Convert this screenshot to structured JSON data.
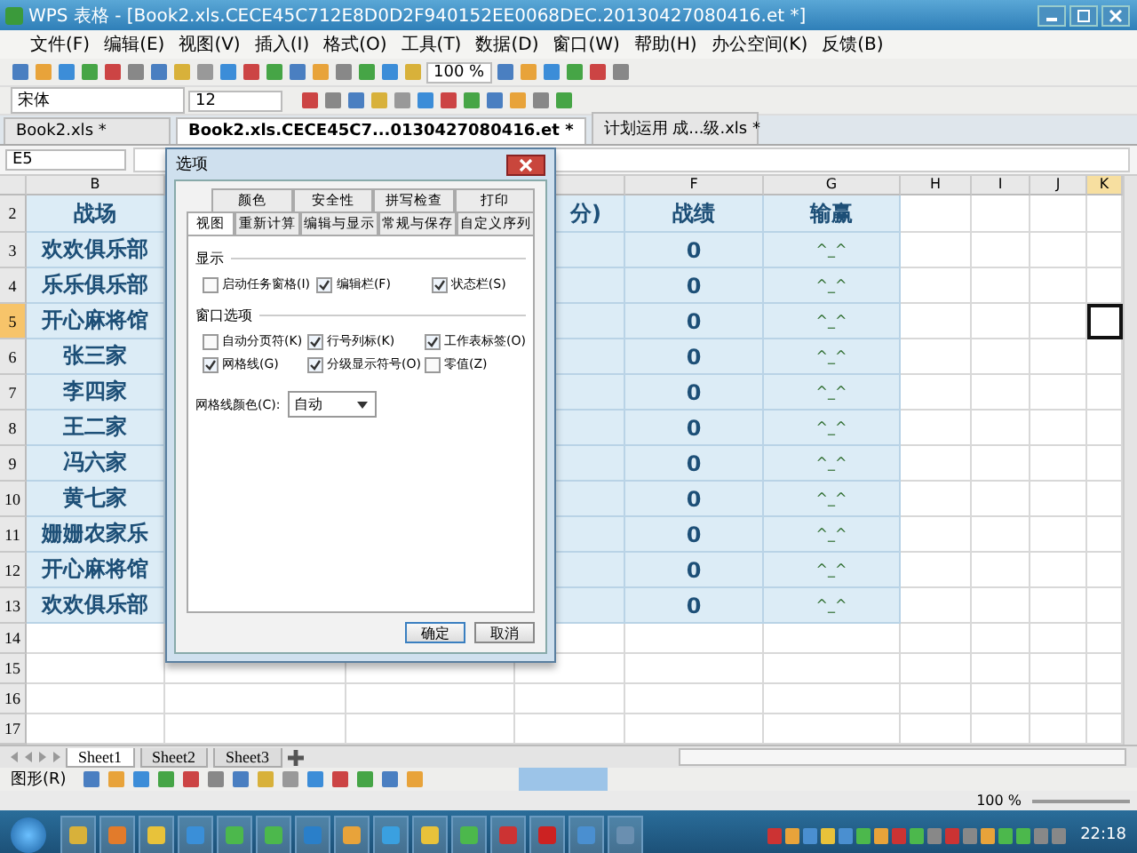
{
  "window": {
    "title": "WPS 表格 - [Book2.xls.CECE45C712E8D0D2F940152EE0068DEC.20130427080416.et *]"
  },
  "menu": [
    "文件(F)",
    "编辑(E)",
    "视图(V)",
    "插入(I)",
    "格式(O)",
    "工具(T)",
    "数据(D)",
    "窗口(W)",
    "帮助(H)",
    "办公空间(K)",
    "反馈(B)"
  ],
  "toolbar": {
    "zoom": "100 %"
  },
  "format_bar": {
    "font": "宋体",
    "size": "12"
  },
  "doc_tabs": [
    {
      "label": "Book2.xls *",
      "selected": false
    },
    {
      "label": "Book2.xls.CECE45C7...0130427080416.et *",
      "selected": true
    },
    {
      "label": "计划运用 成...级.xls *",
      "selected": false
    }
  ],
  "formula_bar": {
    "cell_ref": "E5"
  },
  "columns": [
    {
      "letter": "B",
      "selected": false
    },
    {
      "letter": "F",
      "selected": false
    },
    {
      "letter": "G",
      "selected": false
    },
    {
      "letter": "H",
      "selected": false
    },
    {
      "letter": "I",
      "selected": false
    },
    {
      "letter": "J",
      "selected": false
    },
    {
      "letter": "K",
      "selected": true
    }
  ],
  "rows": [
    {
      "number": "2",
      "kind": "table",
      "selected": false,
      "b": "战场",
      "e": "分)",
      "f": "战绩",
      "g": "输赢"
    },
    {
      "number": "3",
      "kind": "table",
      "selected": false,
      "b": "欢欢俱乐部",
      "f": "0",
      "g": "^_^"
    },
    {
      "number": "4",
      "kind": "table",
      "selected": false,
      "b": "乐乐俱乐部",
      "f": "0",
      "g": "^_^"
    },
    {
      "number": "5",
      "kind": "table",
      "selected": true,
      "b": "开心麻将馆",
      "f": "0",
      "g": "^_^"
    },
    {
      "number": "6",
      "kind": "table",
      "selected": false,
      "b": "张三家",
      "f": "0",
      "g": "^_^"
    },
    {
      "number": "7",
      "kind": "table",
      "selected": false,
      "b": "李四家",
      "f": "0",
      "g": "^_^"
    },
    {
      "number": "8",
      "kind": "table",
      "selected": false,
      "b": "王二家",
      "f": "0",
      "g": "^_^"
    },
    {
      "number": "9",
      "kind": "table",
      "selected": false,
      "b": "冯六家",
      "f": "0",
      "g": "^_^"
    },
    {
      "number": "10",
      "kind": "table",
      "selected": false,
      "b": "黄七家",
      "f": "0",
      "g": "^_^"
    },
    {
      "number": "11",
      "kind": "table",
      "selected": false,
      "b": "姗姗农家乐",
      "f": "0",
      "g": "^_^"
    },
    {
      "number": "12",
      "kind": "table",
      "selected": false,
      "b": "开心麻将馆",
      "f": "0",
      "g": "^_^"
    },
    {
      "number": "13",
      "kind": "table",
      "selected": false,
      "b": "欢欢俱乐部",
      "f": "0",
      "g": "^_^"
    },
    {
      "number": "14",
      "kind": "blank",
      "selected": false
    },
    {
      "number": "15",
      "kind": "blank",
      "selected": false
    },
    {
      "number": "16",
      "kind": "blank",
      "selected": false
    },
    {
      "number": "17",
      "kind": "blank",
      "selected": false
    }
  ],
  "sheet_tabs": [
    {
      "label": "Sheet1",
      "selected": true
    },
    {
      "label": "Sheet2",
      "selected": false
    },
    {
      "label": "Sheet3",
      "selected": false
    }
  ],
  "draw_bar": {
    "label": "图形(R)"
  },
  "status_bar": {
    "zoom": "100 %"
  },
  "taskbar": {
    "time": "22:18"
  },
  "dialog": {
    "title": "选项",
    "tabs_back": [
      {
        "label": "颜色",
        "selected": false
      },
      {
        "label": "安全性",
        "selected": false
      },
      {
        "label": "拼写检查",
        "selected": false
      },
      {
        "label": "打印",
        "selected": false
      }
    ],
    "tabs_front": [
      {
        "label": "视图",
        "selected": true
      },
      {
        "label": "重新计算",
        "selected": false
      },
      {
        "label": "编辑与显示",
        "selected": false
      },
      {
        "label": "常规与保存",
        "selected": false
      },
      {
        "label": "自定义序列",
        "selected": false
      }
    ],
    "groups": [
      {
        "title": "显示",
        "options": [
          {
            "label": "启动任务窗格(I)",
            "checked": false
          },
          {
            "label": "编辑栏(F)",
            "checked": true
          },
          {
            "label": "状态栏(S)",
            "checked": true
          }
        ]
      },
      {
        "title": "窗口选项",
        "options": [
          {
            "label": "自动分页符(K)",
            "checked": false
          },
          {
            "label": "行号列标(K)",
            "checked": true
          },
          {
            "label": "工作表标签(O)",
            "checked": true
          },
          {
            "label": "网格线(G)",
            "checked": true
          },
          {
            "label": "分级显示符号(O)",
            "checked": true
          },
          {
            "label": "零值(Z)",
            "checked": false
          }
        ]
      }
    ],
    "grid_color": {
      "label": "网格线颜色(C):",
      "value": "自动"
    },
    "buttons": [
      "确定",
      "取消"
    ]
  }
}
